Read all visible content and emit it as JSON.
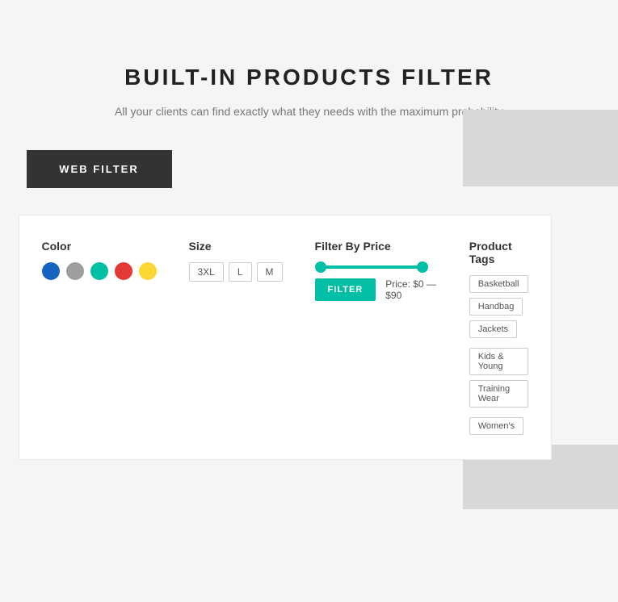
{
  "page": {
    "title": "BUILT-IN PRODUCTS FILTER",
    "subtitle": "All your clients can find exactly what they needs with the maximum probability"
  },
  "web_filter_button": "WEB FILTER",
  "filter_panel": {
    "color_label": "Color",
    "colors": [
      {
        "name": "blue",
        "hex": "#1565c0"
      },
      {
        "name": "gray",
        "hex": "#9e9e9e"
      },
      {
        "name": "teal",
        "hex": "#00bfa5"
      },
      {
        "name": "red",
        "hex": "#e53935"
      },
      {
        "name": "yellow",
        "hex": "#fdd835"
      }
    ],
    "size_label": "Size",
    "sizes": [
      "3XL",
      "L",
      "M"
    ],
    "price_label": "Filter By Price",
    "price_min": "$0",
    "price_max": "$90",
    "price_text": "Price: $0 — $90",
    "filter_button": "FILTER",
    "tags_label": "Product Tags",
    "tags": [
      {
        "label": "Basketball",
        "active": false
      },
      {
        "label": "Handbag",
        "active": false
      },
      {
        "label": "Jackets",
        "active": false
      },
      {
        "label": "Kids & Young",
        "active": false
      },
      {
        "label": "Training Wear",
        "active": false
      },
      {
        "label": "Women's",
        "active": false
      }
    ]
  }
}
